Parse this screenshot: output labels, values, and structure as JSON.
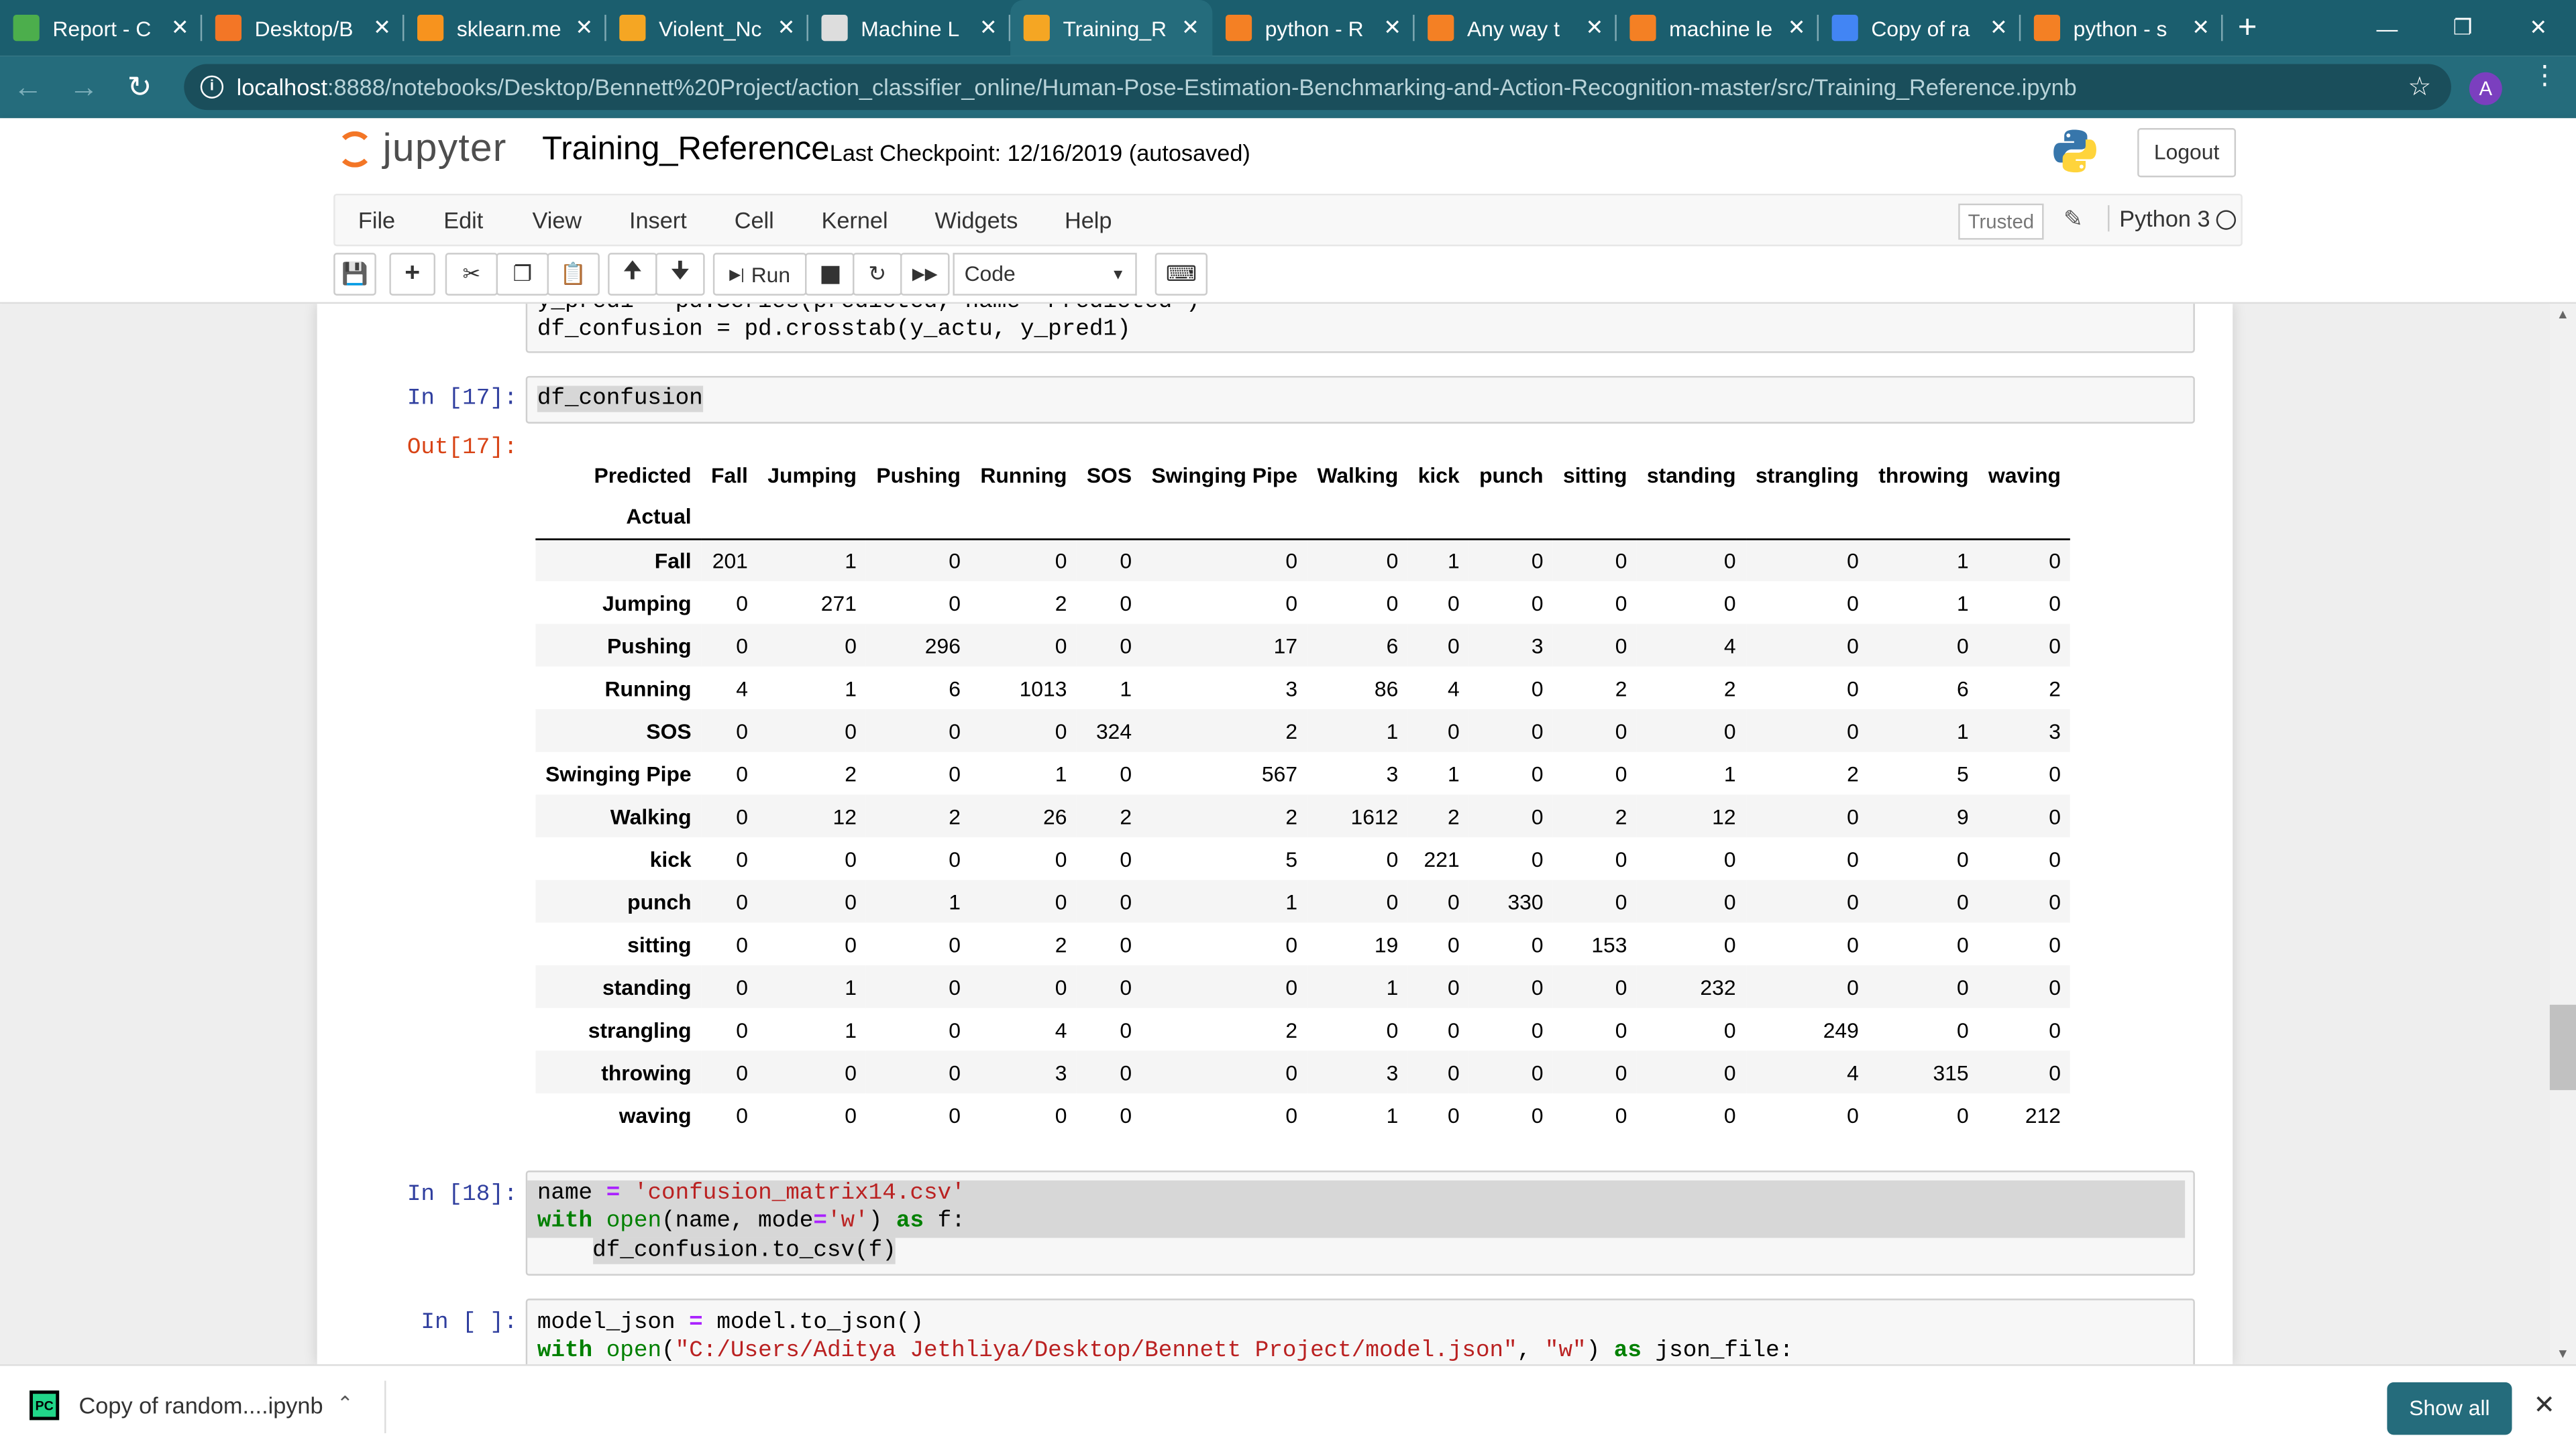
{
  "browser": {
    "tabs": [
      {
        "title": "Report - C",
        "icon": "overleaf-icon",
        "icon_color": "#4cae4c"
      },
      {
        "title": "Desktop/B",
        "icon": "jupyter-icon",
        "icon_color": "#f37626"
      },
      {
        "title": "sklearn.me",
        "icon": "sklearn-icon",
        "icon_color": "#f7931e"
      },
      {
        "title": "Violent_Nc",
        "icon": "notebook-icon",
        "icon_color": "#f5a623"
      },
      {
        "title": "Machine L",
        "icon": "image-icon",
        "icon_color": "#dddddd"
      },
      {
        "title": "Training_R",
        "icon": "notebook-icon",
        "icon_color": "#f5a623",
        "active": true
      },
      {
        "title": "python - R",
        "icon": "stackoverflow-icon",
        "icon_color": "#f48024"
      },
      {
        "title": "Any way t",
        "icon": "stackoverflow-icon",
        "icon_color": "#f48024"
      },
      {
        "title": "machine le",
        "icon": "stackoverflow-icon",
        "icon_color": "#f48024"
      },
      {
        "title": "Copy of ra",
        "icon": "docs-icon",
        "icon_color": "#4285f4"
      },
      {
        "title": "python - s",
        "icon": "stackoverflow-icon",
        "icon_color": "#f48024"
      }
    ],
    "url_host": "localhost",
    "url_path": ":8888/notebooks/Desktop/Bennett%20Project/action_classifier_online/Human-Pose-Estimation-Benchmarking-and-Action-Recognition-master/src/Training_Reference.ipynb",
    "avatar_letter": "A",
    "accent_color": "#256c7c"
  },
  "jupyter": {
    "logo_text": "jupyter",
    "notebook_name": "Training_Reference",
    "checkpoint": "Last Checkpoint: 12/16/2019  (autosaved)",
    "logout_label": "Logout",
    "menu": [
      "File",
      "Edit",
      "View",
      "Insert",
      "Cell",
      "Kernel",
      "Widgets",
      "Help"
    ],
    "trusted_label": "Trusted",
    "kernel_name": "Python 3",
    "run_label": "Run",
    "cell_type": "Code"
  },
  "cells": {
    "prev_line1": "y_pred1 = pd.Series(predicted, name='Predicted')",
    "prev_line2": "df_confusion = pd.crosstab(y_actu, y_pred1)",
    "in17_prompt": "In [17]:",
    "in17_code": "df_confusion",
    "out17_prompt": "Out[17]:",
    "in18_prompt": "In [18]:",
    "in_empty_prompt": "In [ ]:"
  },
  "confusion": {
    "corner_top": "Predicted",
    "corner_bottom": "Actual",
    "columns": [
      "Fall",
      "Jumping",
      "Pushing",
      "Running",
      "SOS",
      "Swinging Pipe",
      "Walking",
      "kick",
      "punch",
      "sitting",
      "standing",
      "strangling",
      "throwing",
      "waving"
    ],
    "rows": [
      {
        "label": "Fall",
        "values": [
          201,
          1,
          0,
          0,
          0,
          0,
          0,
          1,
          0,
          0,
          0,
          0,
          1,
          0
        ]
      },
      {
        "label": "Jumping",
        "values": [
          0,
          271,
          0,
          2,
          0,
          0,
          0,
          0,
          0,
          0,
          0,
          0,
          1,
          0
        ]
      },
      {
        "label": "Pushing",
        "values": [
          0,
          0,
          296,
          0,
          0,
          17,
          6,
          0,
          3,
          0,
          4,
          0,
          0,
          0
        ]
      },
      {
        "label": "Running",
        "values": [
          4,
          1,
          6,
          1013,
          1,
          3,
          86,
          4,
          0,
          2,
          2,
          0,
          6,
          2
        ]
      },
      {
        "label": "SOS",
        "values": [
          0,
          0,
          0,
          0,
          324,
          2,
          1,
          0,
          0,
          0,
          0,
          0,
          1,
          3
        ]
      },
      {
        "label": "Swinging Pipe",
        "values": [
          0,
          2,
          0,
          1,
          0,
          567,
          3,
          1,
          0,
          0,
          1,
          2,
          5,
          0
        ]
      },
      {
        "label": "Walking",
        "values": [
          0,
          12,
          2,
          26,
          2,
          2,
          1612,
          2,
          0,
          2,
          12,
          0,
          9,
          0
        ]
      },
      {
        "label": "kick",
        "values": [
          0,
          0,
          0,
          0,
          0,
          5,
          0,
          221,
          0,
          0,
          0,
          0,
          0,
          0
        ]
      },
      {
        "label": "punch",
        "values": [
          0,
          0,
          1,
          0,
          0,
          1,
          0,
          0,
          330,
          0,
          0,
          0,
          0,
          0
        ]
      },
      {
        "label": "sitting",
        "values": [
          0,
          0,
          0,
          2,
          0,
          0,
          19,
          0,
          0,
          153,
          0,
          0,
          0,
          0
        ]
      },
      {
        "label": "standing",
        "values": [
          0,
          1,
          0,
          0,
          0,
          0,
          1,
          0,
          0,
          0,
          232,
          0,
          0,
          0
        ]
      },
      {
        "label": "strangling",
        "values": [
          0,
          1,
          0,
          4,
          0,
          2,
          0,
          0,
          0,
          0,
          0,
          249,
          0,
          0
        ]
      },
      {
        "label": "throwing",
        "values": [
          0,
          0,
          0,
          3,
          0,
          0,
          3,
          0,
          0,
          0,
          0,
          4,
          315,
          0
        ]
      },
      {
        "label": "waving",
        "values": [
          0,
          0,
          0,
          0,
          0,
          0,
          1,
          0,
          0,
          0,
          0,
          0,
          0,
          212
        ]
      }
    ]
  },
  "downloads": {
    "file": "Copy of random....ipynb",
    "show_all": "Show all"
  }
}
